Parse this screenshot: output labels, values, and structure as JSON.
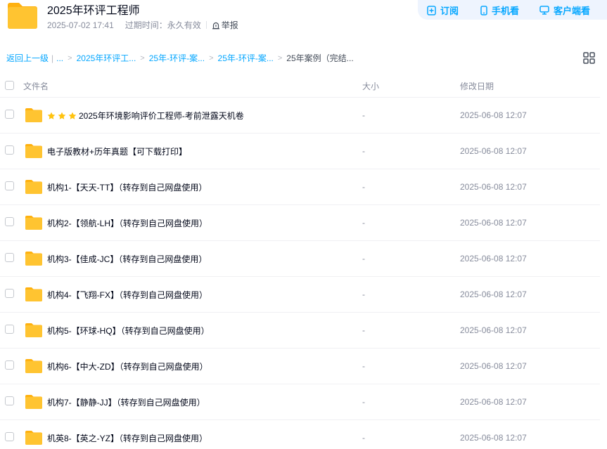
{
  "share": {
    "title": "2025年环评工程师",
    "date": "2025-07-02 17:41",
    "expiry_label": "过期时间：永久有效",
    "report_label": "举报"
  },
  "actions": {
    "subscribe_label": "订阅",
    "mobile_label": "手机看",
    "client_label": "客户端看"
  },
  "breadcrumb": {
    "back_label": "返回上一级",
    "ellipsis": "...",
    "items": [
      "2025年环评工...",
      "25年-环评-案...",
      "25年-环评-案..."
    ],
    "current": "25年案例（完结..."
  },
  "table": {
    "col_name": "文件名",
    "col_size": "大小",
    "col_date": "修改日期"
  },
  "files": [
    {
      "name": "2025年环境影响评价工程师-考前泄露天机卷",
      "stars": 3,
      "size": "-",
      "date": "2025-06-08 12:07"
    },
    {
      "name": "电子版教材+历年真题【可下载打印】",
      "stars": 0,
      "size": "-",
      "date": "2025-06-08 12:07"
    },
    {
      "name": "机构1-【天天-TT】（转存到自己网盘使用）",
      "stars": 0,
      "size": "-",
      "date": "2025-06-08 12:07"
    },
    {
      "name": "机构2-【领航-LH】（转存到自己网盘使用）",
      "stars": 0,
      "size": "-",
      "date": "2025-06-08 12:07"
    },
    {
      "name": "机构3-【佳成-JC】（转存到自己网盘使用）",
      "stars": 0,
      "size": "-",
      "date": "2025-06-08 12:07"
    },
    {
      "name": "机构4-【飞翔-FX】（转存到自己网盘使用）",
      "stars": 0,
      "size": "-",
      "date": "2025-06-08 12:07"
    },
    {
      "name": "机构5-【环球-HQ】（转存到自己网盘使用）",
      "stars": 0,
      "size": "-",
      "date": "2025-06-08 12:07"
    },
    {
      "name": "机构6-【中大-ZD】（转存到自己网盘使用）",
      "stars": 0,
      "size": "-",
      "date": "2025-06-08 12:07"
    },
    {
      "name": "机构7-【静静-JJ】（转存到自己网盘使用）",
      "stars": 0,
      "size": "-",
      "date": "2025-06-08 12:07"
    },
    {
      "name": "机英8-【英之-YZ】（转存到自己网盘使用）",
      "stars": 0,
      "size": "-",
      "date": "2025-06-08 12:07"
    }
  ],
  "colors": {
    "accent": "#06a7ff",
    "folder_yellow": "#ffc431",
    "star_yellow": "#ffc30f"
  },
  "icons": {
    "folder": "folder-icon",
    "star": "star-icon",
    "subscribe": "subscribe-icon",
    "mobile": "phone-icon",
    "client": "monitor-icon",
    "report": "report-icon",
    "grid": "grid-view-icon"
  }
}
